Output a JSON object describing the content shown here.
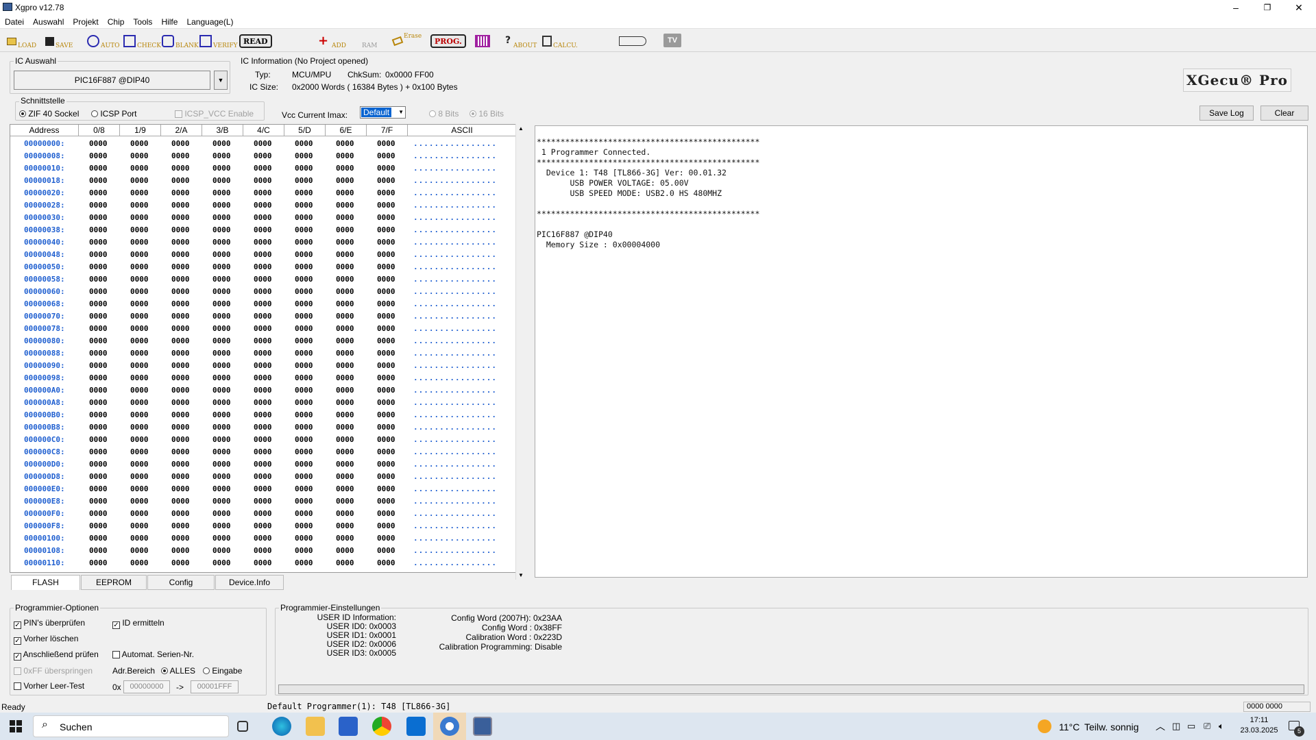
{
  "window": {
    "title": "Xgpro v12.78",
    "min": "–",
    "max": "❐",
    "close": "✕"
  },
  "menu": [
    "Datei",
    "Auswahl",
    "Projekt",
    "Chip",
    "Tools",
    "Hilfe",
    "Language(L)"
  ],
  "toolbar": {
    "load": "LOAD",
    "save": "SAVE",
    "auto": "AUTO",
    "check": "CHECK",
    "blank": "BLANK",
    "verify": "VERIFY",
    "read": "READ",
    "add": "ADD",
    "ram": "RAM",
    "erase": "Erase",
    "prog": "PROG.",
    "about": "ABOUT",
    "calcu": "CALCU.",
    "tv": "TV"
  },
  "ic_auswahl": {
    "label": "IC Auswahl",
    "selected": "PIC16F887 @DIP40"
  },
  "ic_info": {
    "label": "IC Information (No Project opened)",
    "typ_label": "Typ:",
    "typ_value": "MCU/MPU",
    "chksum_label": "ChkSum:",
    "chksum_value": "0x0000 FF00",
    "size_label": "IC Size:",
    "size_value": "0x2000 Words ( 16384 Bytes ) + 0x100 Bytes"
  },
  "brand": "XGecu® Pro",
  "schnittstelle": {
    "label": "Schnittstelle",
    "zif": "ZIF 40 Sockel",
    "icsp": "ICSP Port",
    "icsp_vcc": "ICSP_VCC Enable"
  },
  "vcc": {
    "label": "Vcc Current Imax:",
    "value": "Default"
  },
  "bits": {
    "b8": "8 Bits",
    "b16": "16 Bits"
  },
  "log_buttons": {
    "save": "Save Log",
    "clear": "Clear"
  },
  "grid": {
    "headers": [
      "Address",
      "0/8",
      "1/9",
      "2/A",
      "3/B",
      "4/C",
      "5/D",
      "6/E",
      "7/F",
      "ASCII"
    ],
    "cell": "0000",
    "ascii": "................",
    "addresses": [
      "00000000:",
      "00000008:",
      "00000010:",
      "00000018:",
      "00000020:",
      "00000028:",
      "00000030:",
      "00000038:",
      "00000040:",
      "00000048:",
      "00000050:",
      "00000058:",
      "00000060:",
      "00000068:",
      "00000070:",
      "00000078:",
      "00000080:",
      "00000088:",
      "00000090:",
      "00000098:",
      "000000A0:",
      "000000A8:",
      "000000B0:",
      "000000B8:",
      "000000C0:",
      "000000C8:",
      "000000D0:",
      "000000D8:",
      "000000E0:",
      "000000E8:",
      "000000F0:",
      "000000F8:",
      "00000100:",
      "00000108:",
      "00000110:"
    ]
  },
  "log_lines": [
    "***********************************************",
    " 1 Programmer Connected.",
    "***********************************************",
    "  Device 1: T48 [TL866-3G] Ver: 00.01.32",
    "       USB POWER VOLTAGE: 05.00V",
    "       USB SPEED MODE: USB2.0 HS 480MHZ",
    "",
    "***********************************************",
    "",
    "PIC16F887 @DIP40",
    "  Memory Size : 0x00004000"
  ],
  "tabs": [
    "FLASH",
    "EEPROM",
    "Config",
    "Device.Info"
  ],
  "prog_opts": {
    "label": "Programmier-Optionen",
    "pins": "PIN's überprüfen",
    "id": "ID ermitteln",
    "erase": "Vorher löschen",
    "verify": "Anschließend prüfen",
    "serial": "Automat. Serien-Nr.",
    "skip_ff": "0xFF überspringen",
    "adr_label": "Adr.Bereich",
    "alles": "ALLES",
    "eingabe": "Eingabe",
    "blank": "Vorher Leer-Test",
    "hex_prefix": "0x",
    "from": "00000000",
    "arrow": "->",
    "to": "00001FFF"
  },
  "prog_settings": {
    "label": "Programmier-Einstellungen",
    "left": [
      "USER ID Information:",
      "USER ID0: 0x0003",
      "USER ID1: 0x0001",
      "USER ID2: 0x0006",
      "USER ID3: 0x0005"
    ],
    "right": [
      "Config Word (2007H): 0x23AA",
      "Config Word : 0x38FF",
      "Calibration Word : 0x223D",
      "Calibration Programming: Disable"
    ]
  },
  "status": {
    "left": "Ready",
    "center": "Default Programmer(1): T48 [TL866-3G]",
    "right": "0000 0000"
  },
  "taskbar": {
    "search": "Suchen",
    "weather_temp": "11°C",
    "weather_text": "Teilw. sonnig",
    "time": "17:11",
    "date": "23.03.2025",
    "notif": "5"
  },
  "colors": {
    "address": "#1f5fd0",
    "brand_accent": "#000000",
    "taskbar": "#dde6f0"
  }
}
